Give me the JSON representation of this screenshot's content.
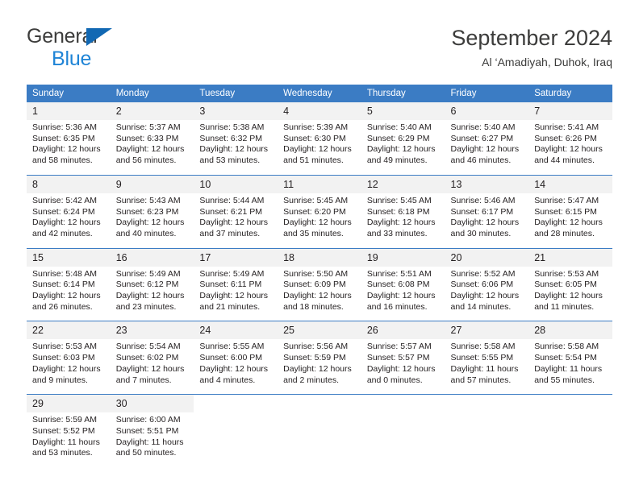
{
  "brand": {
    "line1": "General",
    "line2": "Blue",
    "triangle_color": "#1168b3",
    "line2_color": "#1f84d6"
  },
  "header": {
    "title": "September 2024",
    "subtitle": "Al ‘Amadiyah, Duhok, Iraq"
  },
  "theme": {
    "header_bg": "#3b7cc4",
    "daynum_bg": "#f2f2f2",
    "text": "#231f20",
    "separator": "#3b7cc4"
  },
  "labels": {
    "sunrise_prefix": "Sunrise:",
    "sunset_prefix": "Sunset:",
    "daylight_prefix": "Daylight:"
  },
  "weekday_headers": [
    "Sunday",
    "Monday",
    "Tuesday",
    "Wednesday",
    "Thursday",
    "Friday",
    "Saturday"
  ],
  "weeks": [
    [
      {
        "day": "1",
        "sunrise": "Sunrise: 5:36 AM",
        "sunset": "Sunset: 6:35 PM",
        "daylight_line1": "Daylight: 12 hours",
        "daylight_line2": "and 58 minutes."
      },
      {
        "day": "2",
        "sunrise": "Sunrise: 5:37 AM",
        "sunset": "Sunset: 6:33 PM",
        "daylight_line1": "Daylight: 12 hours",
        "daylight_line2": "and 56 minutes."
      },
      {
        "day": "3",
        "sunrise": "Sunrise: 5:38 AM",
        "sunset": "Sunset: 6:32 PM",
        "daylight_line1": "Daylight: 12 hours",
        "daylight_line2": "and 53 minutes."
      },
      {
        "day": "4",
        "sunrise": "Sunrise: 5:39 AM",
        "sunset": "Sunset: 6:30 PM",
        "daylight_line1": "Daylight: 12 hours",
        "daylight_line2": "and 51 minutes."
      },
      {
        "day": "5",
        "sunrise": "Sunrise: 5:40 AM",
        "sunset": "Sunset: 6:29 PM",
        "daylight_line1": "Daylight: 12 hours",
        "daylight_line2": "and 49 minutes."
      },
      {
        "day": "6",
        "sunrise": "Sunrise: 5:40 AM",
        "sunset": "Sunset: 6:27 PM",
        "daylight_line1": "Daylight: 12 hours",
        "daylight_line2": "and 46 minutes."
      },
      {
        "day": "7",
        "sunrise": "Sunrise: 5:41 AM",
        "sunset": "Sunset: 6:26 PM",
        "daylight_line1": "Daylight: 12 hours",
        "daylight_line2": "and 44 minutes."
      }
    ],
    [
      {
        "day": "8",
        "sunrise": "Sunrise: 5:42 AM",
        "sunset": "Sunset: 6:24 PM",
        "daylight_line1": "Daylight: 12 hours",
        "daylight_line2": "and 42 minutes."
      },
      {
        "day": "9",
        "sunrise": "Sunrise: 5:43 AM",
        "sunset": "Sunset: 6:23 PM",
        "daylight_line1": "Daylight: 12 hours",
        "daylight_line2": "and 40 minutes."
      },
      {
        "day": "10",
        "sunrise": "Sunrise: 5:44 AM",
        "sunset": "Sunset: 6:21 PM",
        "daylight_line1": "Daylight: 12 hours",
        "daylight_line2": "and 37 minutes."
      },
      {
        "day": "11",
        "sunrise": "Sunrise: 5:45 AM",
        "sunset": "Sunset: 6:20 PM",
        "daylight_line1": "Daylight: 12 hours",
        "daylight_line2": "and 35 minutes."
      },
      {
        "day": "12",
        "sunrise": "Sunrise: 5:45 AM",
        "sunset": "Sunset: 6:18 PM",
        "daylight_line1": "Daylight: 12 hours",
        "daylight_line2": "and 33 minutes."
      },
      {
        "day": "13",
        "sunrise": "Sunrise: 5:46 AM",
        "sunset": "Sunset: 6:17 PM",
        "daylight_line1": "Daylight: 12 hours",
        "daylight_line2": "and 30 minutes."
      },
      {
        "day": "14",
        "sunrise": "Sunrise: 5:47 AM",
        "sunset": "Sunset: 6:15 PM",
        "daylight_line1": "Daylight: 12 hours",
        "daylight_line2": "and 28 minutes."
      }
    ],
    [
      {
        "day": "15",
        "sunrise": "Sunrise: 5:48 AM",
        "sunset": "Sunset: 6:14 PM",
        "daylight_line1": "Daylight: 12 hours",
        "daylight_line2": "and 26 minutes."
      },
      {
        "day": "16",
        "sunrise": "Sunrise: 5:49 AM",
        "sunset": "Sunset: 6:12 PM",
        "daylight_line1": "Daylight: 12 hours",
        "daylight_line2": "and 23 minutes."
      },
      {
        "day": "17",
        "sunrise": "Sunrise: 5:49 AM",
        "sunset": "Sunset: 6:11 PM",
        "daylight_line1": "Daylight: 12 hours",
        "daylight_line2": "and 21 minutes."
      },
      {
        "day": "18",
        "sunrise": "Sunrise: 5:50 AM",
        "sunset": "Sunset: 6:09 PM",
        "daylight_line1": "Daylight: 12 hours",
        "daylight_line2": "and 18 minutes."
      },
      {
        "day": "19",
        "sunrise": "Sunrise: 5:51 AM",
        "sunset": "Sunset: 6:08 PM",
        "daylight_line1": "Daylight: 12 hours",
        "daylight_line2": "and 16 minutes."
      },
      {
        "day": "20",
        "sunrise": "Sunrise: 5:52 AM",
        "sunset": "Sunset: 6:06 PM",
        "daylight_line1": "Daylight: 12 hours",
        "daylight_line2": "and 14 minutes."
      },
      {
        "day": "21",
        "sunrise": "Sunrise: 5:53 AM",
        "sunset": "Sunset: 6:05 PM",
        "daylight_line1": "Daylight: 12 hours",
        "daylight_line2": "and 11 minutes."
      }
    ],
    [
      {
        "day": "22",
        "sunrise": "Sunrise: 5:53 AM",
        "sunset": "Sunset: 6:03 PM",
        "daylight_line1": "Daylight: 12 hours",
        "daylight_line2": "and 9 minutes."
      },
      {
        "day": "23",
        "sunrise": "Sunrise: 5:54 AM",
        "sunset": "Sunset: 6:02 PM",
        "daylight_line1": "Daylight: 12 hours",
        "daylight_line2": "and 7 minutes."
      },
      {
        "day": "24",
        "sunrise": "Sunrise: 5:55 AM",
        "sunset": "Sunset: 6:00 PM",
        "daylight_line1": "Daylight: 12 hours",
        "daylight_line2": "and 4 minutes."
      },
      {
        "day": "25",
        "sunrise": "Sunrise: 5:56 AM",
        "sunset": "Sunset: 5:59 PM",
        "daylight_line1": "Daylight: 12 hours",
        "daylight_line2": "and 2 minutes."
      },
      {
        "day": "26",
        "sunrise": "Sunrise: 5:57 AM",
        "sunset": "Sunset: 5:57 PM",
        "daylight_line1": "Daylight: 12 hours",
        "daylight_line2": "and 0 minutes."
      },
      {
        "day": "27",
        "sunrise": "Sunrise: 5:58 AM",
        "sunset": "Sunset: 5:55 PM",
        "daylight_line1": "Daylight: 11 hours",
        "daylight_line2": "and 57 minutes."
      },
      {
        "day": "28",
        "sunrise": "Sunrise: 5:58 AM",
        "sunset": "Sunset: 5:54 PM",
        "daylight_line1": "Daylight: 11 hours",
        "daylight_line2": "and 55 minutes."
      }
    ],
    [
      {
        "day": "29",
        "sunrise": "Sunrise: 5:59 AM",
        "sunset": "Sunset: 5:52 PM",
        "daylight_line1": "Daylight: 11 hours",
        "daylight_line2": "and 53 minutes."
      },
      {
        "day": "30",
        "sunrise": "Sunrise: 6:00 AM",
        "sunset": "Sunset: 5:51 PM",
        "daylight_line1": "Daylight: 11 hours",
        "daylight_line2": "and 50 minutes."
      },
      {
        "day": "",
        "sunrise": "",
        "sunset": "",
        "daylight_line1": "",
        "daylight_line2": ""
      },
      {
        "day": "",
        "sunrise": "",
        "sunset": "",
        "daylight_line1": "",
        "daylight_line2": ""
      },
      {
        "day": "",
        "sunrise": "",
        "sunset": "",
        "daylight_line1": "",
        "daylight_line2": ""
      },
      {
        "day": "",
        "sunrise": "",
        "sunset": "",
        "daylight_line1": "",
        "daylight_line2": ""
      },
      {
        "day": "",
        "sunrise": "",
        "sunset": "",
        "daylight_line1": "",
        "daylight_line2": ""
      }
    ]
  ]
}
